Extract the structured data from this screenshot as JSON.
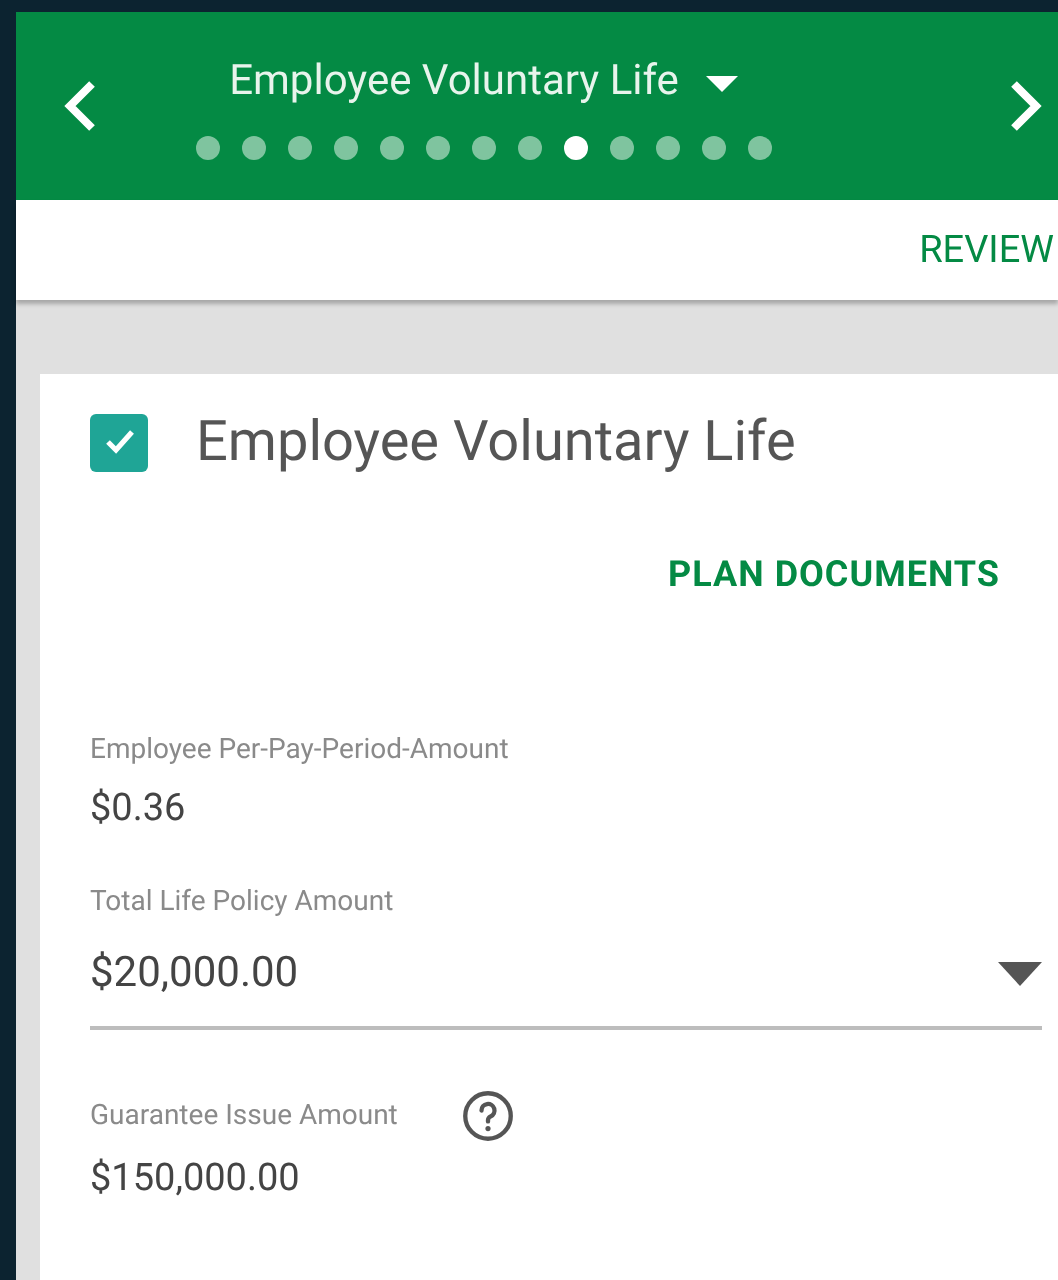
{
  "header": {
    "title": "Employee Voluntary Life",
    "steps": [
      {
        "selected": false
      },
      {
        "selected": false
      },
      {
        "selected": false
      },
      {
        "selected": false
      },
      {
        "selected": false
      },
      {
        "selected": false
      },
      {
        "selected": false
      },
      {
        "selected": false
      },
      {
        "selected": true
      },
      {
        "selected": false
      },
      {
        "selected": false
      },
      {
        "selected": false
      },
      {
        "selected": false
      }
    ]
  },
  "review_button": "REVIEW",
  "card": {
    "title": "Employee Voluntary Life",
    "checked": true,
    "plan_documents": "PLAN DOCUMENTS",
    "fields": [
      {
        "kind": "text",
        "label": "Employee Per-Pay-Period-Amount",
        "value": "$0.36",
        "help": false
      },
      {
        "kind": "select",
        "label": "Total Life Policy Amount",
        "value": "$20,000.00",
        "help": false
      },
      {
        "kind": "text",
        "label": "Guarantee Issue Amount",
        "value": "$150,000.00",
        "help": true
      }
    ]
  }
}
